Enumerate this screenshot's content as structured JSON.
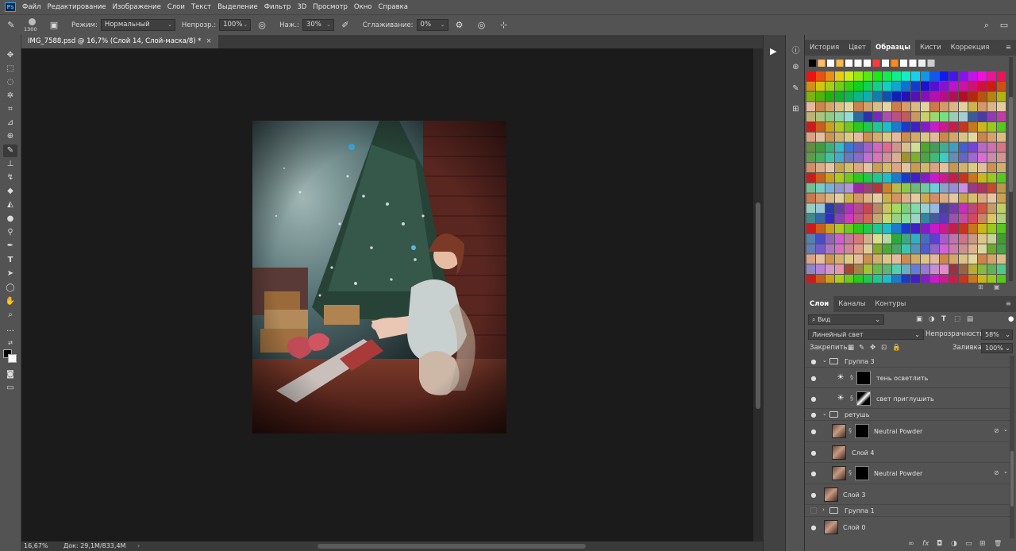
{
  "menubar": {
    "logo": "Ps",
    "items": [
      "Файл",
      "Редактирование",
      "Изображение",
      "Слои",
      "Текст",
      "Выделение",
      "Фильтр",
      "3D",
      "Просмотр",
      "Окно",
      "Справка"
    ]
  },
  "options": {
    "brush_size": "1300",
    "mode_label": "Режим:",
    "mode_value": "Нормальный",
    "opacity_label": "Непрозр.:",
    "opacity_value": "100%",
    "pressure_label": "Наж.:",
    "pressure_value": "30%",
    "smoothing_label": "Сглаживание:",
    "smoothing_value": "0%"
  },
  "document": {
    "tab_title": "IMG_7588.psd @ 16,7% (Слой 14, Слой-маска/8) *",
    "close": "×",
    "zoom": "16,67%",
    "doc_info": "Док: 29,1M/833,4M",
    "status_arrow": "›"
  },
  "swatches_panel": {
    "tabs": [
      "История",
      "Цвет",
      "Образцы",
      "Кисти",
      "Коррекция"
    ],
    "active_tab": "Образцы",
    "menu_icon": "≡"
  },
  "layers_panel": {
    "tabs": [
      "Слои",
      "Каналы",
      "Контуры"
    ],
    "active_tab": "Слои",
    "filter_value": "Вид",
    "blend_mode": "Линейный свет",
    "opacity_label": "Непрозрачность:",
    "opacity_value": "58%",
    "lock_label": "Закрепить:",
    "fill_label": "Заливка:",
    "fill_value": "100%",
    "layers": [
      {
        "name": "Группа 3",
        "kind": "group",
        "visible": true,
        "expanded": true
      },
      {
        "name": "тень осветлить",
        "kind": "adjustment",
        "visible": true
      },
      {
        "name": "свет приглушить",
        "kind": "adjustment",
        "visible": true
      },
      {
        "name": "ретушь",
        "kind": "group",
        "visible": true,
        "expanded": true
      },
      {
        "name": "Neutral Powder",
        "kind": "masked",
        "visible": true
      },
      {
        "name": "Слой 4",
        "kind": "pixel",
        "visible": true
      },
      {
        "name": "Neutral Powder",
        "kind": "masked",
        "visible": true
      },
      {
        "name": "Слой 3",
        "kind": "pixel",
        "visible": true
      },
      {
        "name": "Группа 1",
        "kind": "group",
        "visible": false,
        "expanded": false
      },
      {
        "name": "Слой 0",
        "kind": "pixel",
        "visible": true
      }
    ],
    "footer_icons": [
      "link-icon",
      "fx-icon",
      "mask-icon",
      "adjustment-icon",
      "folder-icon",
      "new-layer-icon",
      "trash-icon"
    ],
    "footer_glyphs": [
      "∞",
      "fx",
      "◘",
      "◑",
      "▭",
      "⊞",
      "🗑"
    ]
  },
  "icons": {
    "eye": "●",
    "chain": "§",
    "arrow": "▶"
  }
}
